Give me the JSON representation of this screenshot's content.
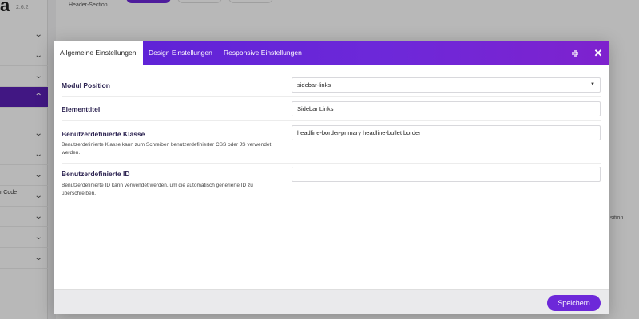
{
  "background": {
    "logo_text": "a",
    "version": "2.6.2",
    "header_label": "Header-Section",
    "sidebar_code_label": "r Code",
    "side_text": "sition"
  },
  "modal": {
    "tabs": [
      {
        "label": "Allgemeine Einstellungen",
        "active": true
      },
      {
        "label": "Design Einstellungen",
        "active": false
      },
      {
        "label": "Responsive Einstellungen",
        "active": false
      }
    ],
    "icons": {
      "collapse": "collapse-icon",
      "close": "close-icon",
      "close_glyph": "✕",
      "collapse_glyph": "⤡"
    },
    "fields": {
      "position": {
        "label": "Modul Position",
        "value": "sidebar-links"
      },
      "title": {
        "label": "Elementtitel",
        "value": "Sidebar Links"
      },
      "css_class": {
        "label": "Benutzerdefinierte Klasse",
        "help": "Benutzerdefinierte Klasse kann zum Schreiben benutzerdefinierter CSS oder JS verwendet werden.",
        "value": "headline-border-primary headline-bullet border"
      },
      "custom_id": {
        "label": "Benutzerdefinierte ID",
        "help": "Benutzerdefinierte ID kann verwendet werden, um die automatisch generierte ID zu überschreiben.",
        "value": ""
      }
    },
    "footer": {
      "save_label": "Speichern"
    },
    "colors": {
      "accent": "#6d28d9",
      "header_gradient_start": "#5b21d6",
      "header_gradient_end": "#7e22ce"
    }
  }
}
